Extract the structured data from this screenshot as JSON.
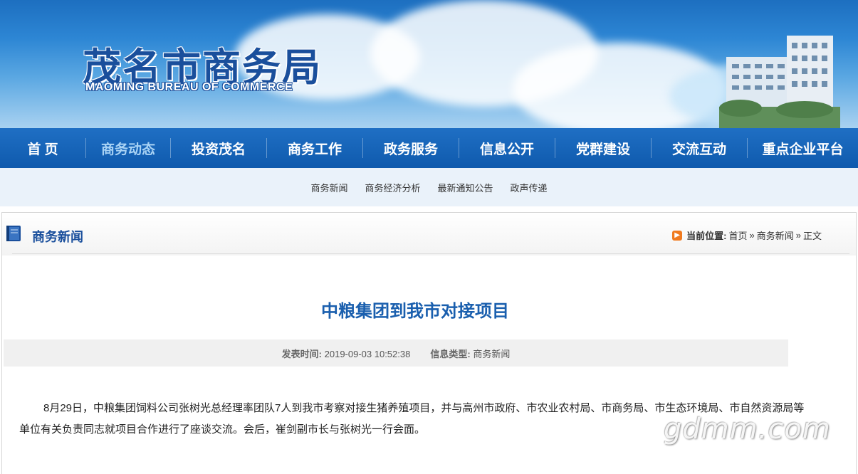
{
  "header": {
    "logo_cn": "茂名市商务局",
    "logo_en": "MAOMING BUREAU OF COMMERCE"
  },
  "nav": {
    "items": [
      {
        "label": "首 页",
        "active": false
      },
      {
        "label": "商务动态",
        "active": true
      },
      {
        "label": "投资茂名",
        "active": false
      },
      {
        "label": "商务工作",
        "active": false
      },
      {
        "label": "政务服务",
        "active": false
      },
      {
        "label": "信息公开",
        "active": false
      },
      {
        "label": "党群建设",
        "active": false
      },
      {
        "label": "交流互动",
        "active": false
      },
      {
        "label": "重点企业平台",
        "active": false
      }
    ]
  },
  "subnav": {
    "items": [
      "商务新闻",
      "商务经济分析",
      "最新通知公告",
      "政声传递"
    ]
  },
  "section": {
    "title": "商务新闻",
    "breadcrumb_label": "当前位置:",
    "crumbs": [
      "首页",
      "商务新闻",
      "正文"
    ],
    "separator": "»"
  },
  "article": {
    "title": "中粮集团到我市对接项目",
    "publish_label": "发表时间:",
    "publish_time": "2019-09-03 10:52:38",
    "type_label": "信息类型:",
    "type_value": "商务新闻",
    "body": "8月29日，中粮集团饲料公司张树光总经理率团队7人到我市考察对接生猪养殖项目，并与高州市政府、市农业农村局、市商务局、市生态环境局、市自然资源局等单位有关负责同志就项目合作进行了座谈交流。会后，崔剑副市长与张树光一行会面。"
  },
  "watermark": "gdmm.com",
  "colors": {
    "nav_bg": "#0f5aad",
    "title_blue": "#1a5fae",
    "accent_orange": "#f07a1f"
  }
}
